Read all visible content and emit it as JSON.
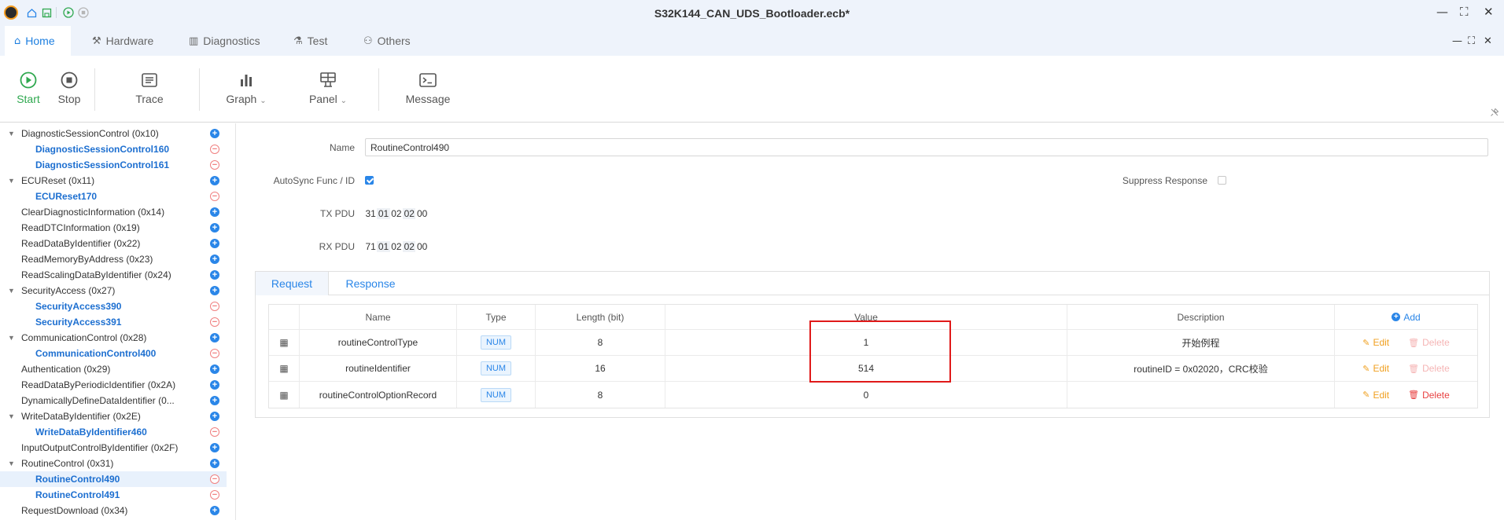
{
  "window": {
    "title": "S32K144_CAN_UDS_Bootloader.ecb*",
    "controls": {
      "minimize": "—",
      "maximize": "⛶",
      "close": "✕"
    }
  },
  "menu": {
    "tabs": [
      {
        "label": "Home",
        "icon": "home-gear-icon",
        "active": true
      },
      {
        "label": "Hardware",
        "icon": "hammer-icon"
      },
      {
        "label": "Diagnostics",
        "icon": "book-icon"
      },
      {
        "label": "Test",
        "icon": "flask-icon"
      },
      {
        "label": "Others",
        "icon": "user-icon"
      }
    ]
  },
  "ribbon": {
    "start": "Start",
    "stop": "Stop",
    "trace": "Trace",
    "graph": "Graph",
    "panel": "Panel",
    "message": "Message",
    "dropdown_glyph": "⌄"
  },
  "tree": {
    "items": [
      {
        "label": "DiagnosticSessionControl (0x10)",
        "level": 0,
        "expandable": true,
        "button": "add"
      },
      {
        "label": "DiagnosticSessionControl160",
        "level": 1,
        "button": "remove"
      },
      {
        "label": "DiagnosticSessionControl161",
        "level": 1,
        "button": "remove"
      },
      {
        "label": "ECUReset (0x11)",
        "level": 0,
        "expandable": true,
        "button": "add"
      },
      {
        "label": "ECUReset170",
        "level": 1,
        "button": "remove"
      },
      {
        "label": "ClearDiagnosticInformation (0x14)",
        "level": 0,
        "button": "add"
      },
      {
        "label": "ReadDTCInformation (0x19)",
        "level": 0,
        "button": "add"
      },
      {
        "label": "ReadDataByIdentifier (0x22)",
        "level": 0,
        "button": "add"
      },
      {
        "label": "ReadMemoryByAddress (0x23)",
        "level": 0,
        "button": "add"
      },
      {
        "label": "ReadScalingDataByIdentifier (0x24)",
        "level": 0,
        "button": "add"
      },
      {
        "label": "SecurityAccess (0x27)",
        "level": 0,
        "expandable": true,
        "button": "add"
      },
      {
        "label": "SecurityAccess390",
        "level": 1,
        "button": "remove"
      },
      {
        "label": "SecurityAccess391",
        "level": 1,
        "button": "remove"
      },
      {
        "label": "CommunicationControl (0x28)",
        "level": 0,
        "expandable": true,
        "button": "add"
      },
      {
        "label": "CommunicationControl400",
        "level": 1,
        "button": "remove"
      },
      {
        "label": "Authentication (0x29)",
        "level": 0,
        "button": "add"
      },
      {
        "label": "ReadDataByPeriodicIdentifier (0x2A)",
        "level": 0,
        "button": "add"
      },
      {
        "label": "DynamicallyDefineDataIdentifier (0...",
        "level": 0,
        "button": "add"
      },
      {
        "label": "WriteDataByIdentifier (0x2E)",
        "level": 0,
        "expandable": true,
        "button": "add"
      },
      {
        "label": "WriteDataByIdentifier460",
        "level": 1,
        "button": "remove"
      },
      {
        "label": "InputOutputControlByIdentifier (0x2F)",
        "level": 0,
        "button": "add"
      },
      {
        "label": "RoutineControl (0x31)",
        "level": 0,
        "expandable": true,
        "button": "add"
      },
      {
        "label": "RoutineControl490",
        "level": 1,
        "button": "remove",
        "selected": true
      },
      {
        "label": "RoutineControl491",
        "level": 1,
        "button": "remove"
      },
      {
        "label": "RequestDownload (0x34)",
        "level": 0,
        "button": "add"
      }
    ]
  },
  "form": {
    "name_label": "Name",
    "name_value": "RoutineControl490",
    "autosync_label": "AutoSync Func / ID",
    "autosync_checked": true,
    "suppress_label": "Suppress Response",
    "suppress_checked": false,
    "tx_label": "TX PDU",
    "tx_bytes": [
      "31",
      "01",
      "02",
      "02",
      "00"
    ],
    "rx_label": "RX PDU",
    "rx_bytes": [
      "71",
      "01",
      "02",
      "02",
      "00"
    ]
  },
  "panel": {
    "tabs": [
      "Request",
      "Response"
    ],
    "active_tab": "Request",
    "columns": {
      "name": "Name",
      "type": "Type",
      "length": "Length (bit)",
      "value": "Value",
      "description": "Description",
      "add": "Add"
    },
    "rows": [
      {
        "name": "routineControlType",
        "type": "NUM",
        "length": "8",
        "value": "1",
        "description": "开始例程",
        "edit": "Edit",
        "delete": "Delete",
        "delete_enabled": false
      },
      {
        "name": "routineIdentifier",
        "type": "NUM",
        "length": "16",
        "value": "514",
        "description": "routineID = 0x02020，CRC校验",
        "edit": "Edit",
        "delete": "Delete",
        "delete_enabled": false
      },
      {
        "name": "routineControlOptionRecord",
        "type": "NUM",
        "length": "8",
        "value": "0",
        "description": "",
        "edit": "Edit",
        "delete": "Delete",
        "delete_enabled": true
      }
    ]
  },
  "colors": {
    "accent": "#2a86e8",
    "start_green": "#2fa84f",
    "highlight_red": "#e01919",
    "edit_orange": "#f0a020",
    "delete_red": "#e84040"
  }
}
